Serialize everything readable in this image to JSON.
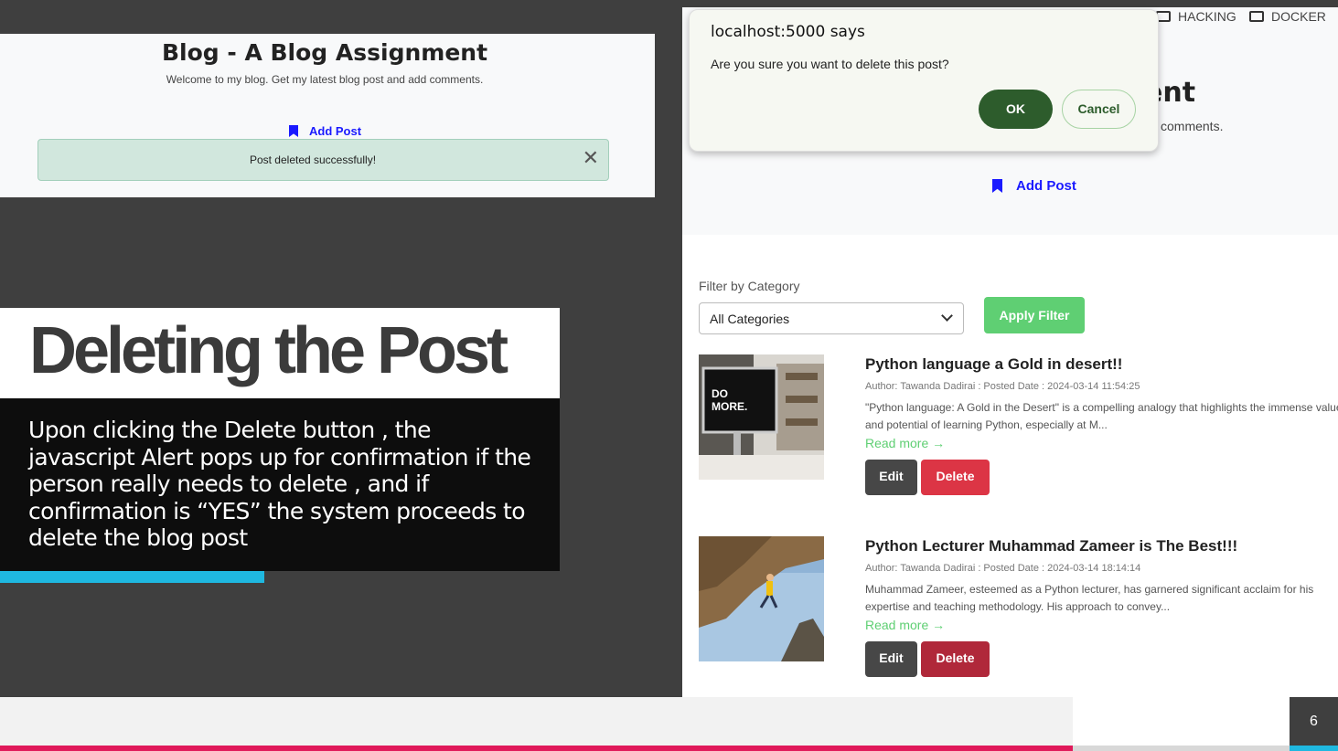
{
  "left_screenshot": {
    "blog_title": "Blog - A Blog Assignment",
    "subtitle": "Welcome to my blog. Get my latest blog post and add comments.",
    "add_post": "Add Post",
    "alert_message": "Post deleted successfully!",
    "close_glyph": "✕"
  },
  "slide": {
    "heading": "Deleting the Post",
    "description": "Upon clicking the Delete button , the javascript Alert pops up for confirmation if the person really needs to delete , and if confirmation is “YES” the system proceeds to delete the blog post",
    "page_number": "6",
    "colors": {
      "accent_cyan": "#1fb8e0",
      "accent_pink": "#e0195a",
      "dark": "#3f3f3f"
    }
  },
  "right_screenshot": {
    "nav": [
      {
        "label": "HACKING",
        "icon": "folder-icon"
      },
      {
        "label": "DOCKER",
        "icon": "folder-icon"
      }
    ],
    "title_fragment": "ent",
    "subtitle_fragment": "comments.",
    "add_post": "Add Post",
    "filter_label": "Filter by Category",
    "category_selected": "All Categories",
    "apply_filter": "Apply Filter",
    "posts": [
      {
        "title": "Python language a Gold in desert!!",
        "meta": "Author: Tawanda Dadirai : Posted Date : 2024-03-14 11:54:25",
        "excerpt": "\"Python language: A Gold in the Desert\" is a compelling analogy that highlights the immense value and potential of learning Python, especially at M...",
        "read_more": "Read more →",
        "edit": "Edit",
        "delete": "Delete",
        "delete_color": "#dc3545",
        "thumb_text": "DO MORE."
      },
      {
        "title": "Python Lecturer Muhammad Zameer is The Best!!!",
        "meta": "Author: Tawanda Dadirai : Posted Date : 2024-03-14 18:14:14",
        "excerpt": "Muhammad Zameer, esteemed as a Python lecturer, has garnered significant acclaim for his expertise and teaching methodology. His approach to convey...",
        "read_more": "Read more →",
        "edit": "Edit",
        "delete": "Delete",
        "delete_color": "#b0283a"
      }
    ]
  },
  "dialog": {
    "title": "localhost:5000 says",
    "message": "Are you sure you want to delete this post?",
    "ok": "OK",
    "cancel": "Cancel"
  }
}
